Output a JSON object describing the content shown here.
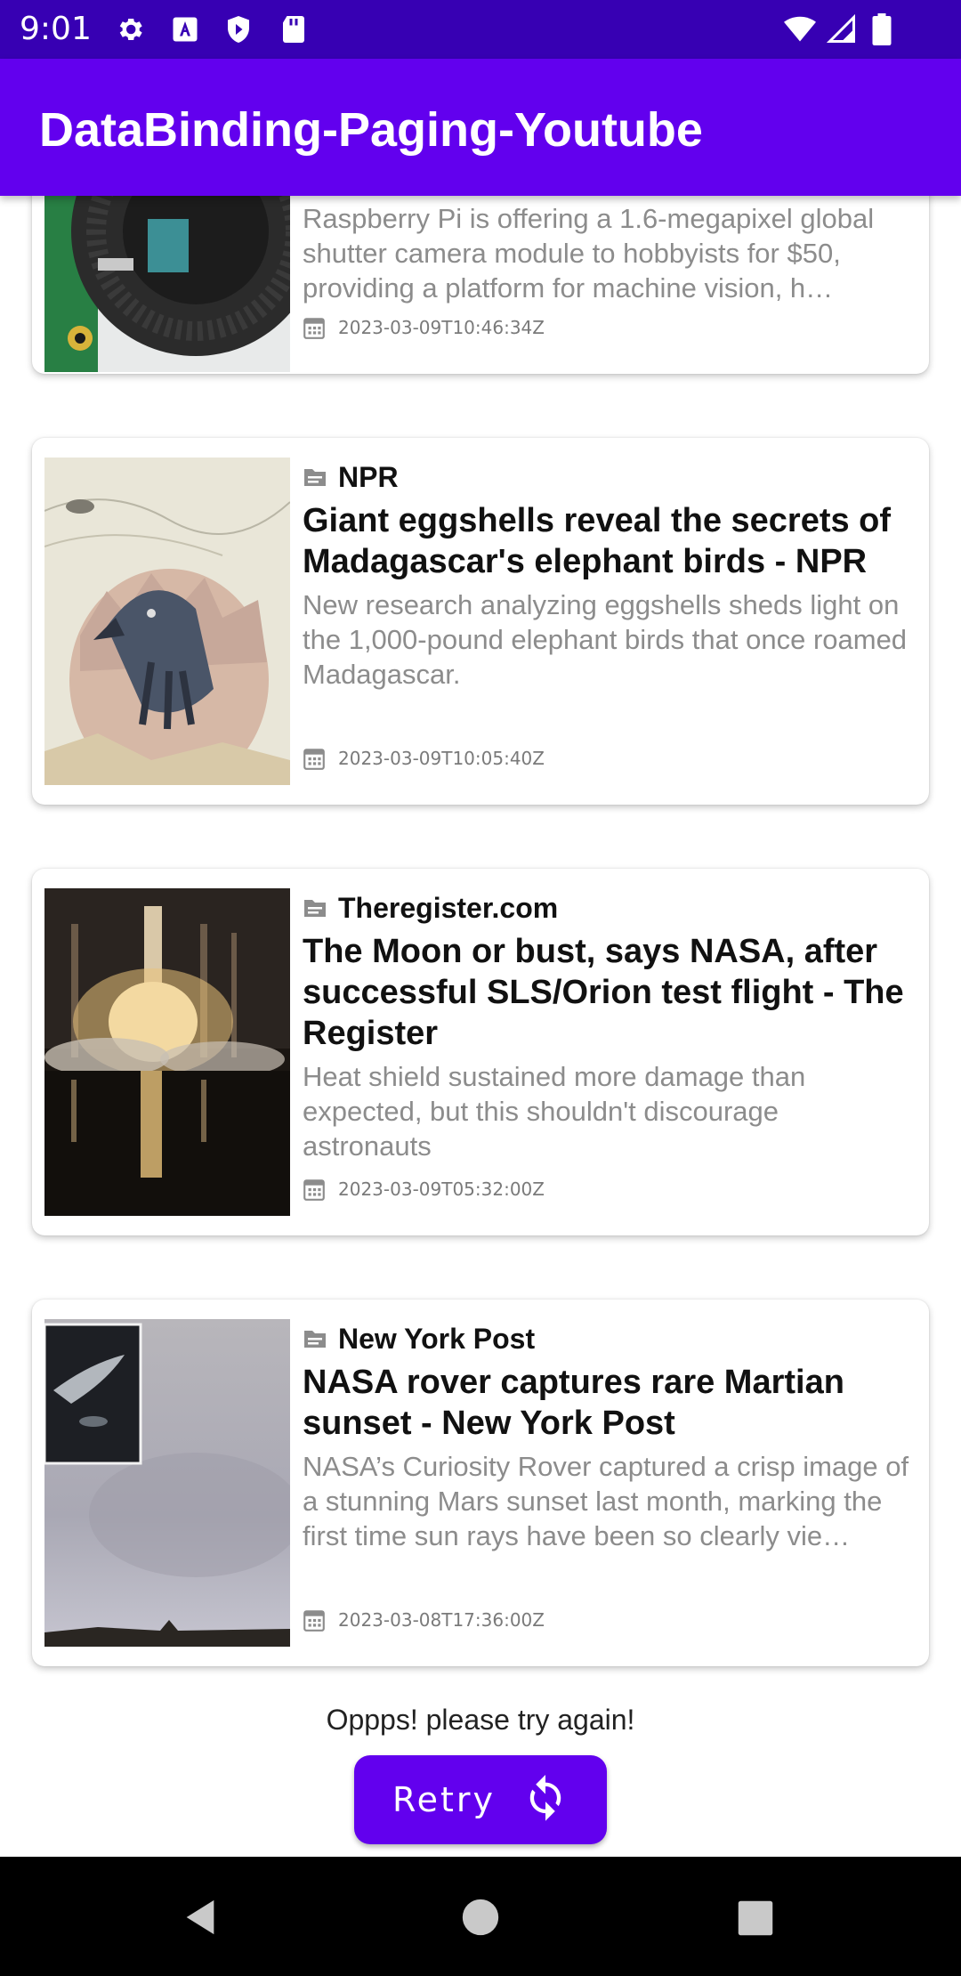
{
  "status_bar": {
    "time": "9:01",
    "left_icons": [
      "settings-icon",
      "keyboard-a-icon",
      "shield-icon",
      "sd-card-icon"
    ],
    "right_icons": [
      "wifi-icon",
      "signal-icon",
      "battery-icon"
    ]
  },
  "app_bar": {
    "title": "DataBinding-Paging-Youtube"
  },
  "articles": [
    {
      "source": "",
      "title": "",
      "description": "Raspberry Pi is offering a 1.6-megapixel global shutter camera module to hobbyists for $50, providing a platform for machine vision, h…",
      "published_at": "2023-03-09T10:46:34Z"
    },
    {
      "source": "NPR",
      "title": "Giant eggshells reveal the secrets of Madagascar's elephant birds - NPR",
      "description": "New research analyzing eggshells sheds light on the 1,000-pound elephant birds that once roamed Madagascar.",
      "published_at": "2023-03-09T10:05:40Z"
    },
    {
      "source": "Theregister.com",
      "title": "The Moon or bust, says NASA, after successful SLS/Orion test flight - The Register",
      "description": "Heat shield sustained more damage than expected, but this shouldn't discourage astronauts",
      "published_at": "2023-03-09T05:32:00Z"
    },
    {
      "source": "New York Post",
      "title": "NASA rover captures rare Martian sunset - New York Post",
      "description": "NASA’s Curiosity Rover captured a crisp image of a stunning Mars sunset last month, marking the first time sun rays have been so clearly vie…",
      "published_at": "2023-03-08T17:36:00Z"
    }
  ],
  "footer": {
    "error_message": "Oppps! please try again!",
    "retry_label": "Retry",
    "retry_icon": "refresh-icon"
  },
  "nav_bar": {
    "icons": [
      "back-icon",
      "home-icon",
      "recents-icon"
    ]
  },
  "colors": {
    "status_bar": "#3700b3",
    "primary": "#6200ee",
    "description_text": "#8c8c8c"
  }
}
